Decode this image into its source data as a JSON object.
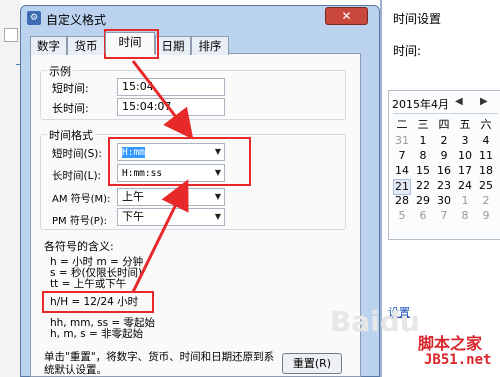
{
  "background_window": {
    "title": "时间设置",
    "label": "时间:",
    "calendar": {
      "month_label": "2015年4月",
      "prev": "◀",
      "next": "▶",
      "weekdays": [
        "二",
        "三",
        "四",
        "五",
        "六"
      ],
      "rows": [
        [
          "31",
          "1",
          "2",
          "3",
          "4"
        ],
        [
          "7",
          "8",
          "9",
          "10",
          "11"
        ],
        [
          "14",
          "15",
          "16",
          "17",
          "18"
        ],
        [
          "21",
          "22",
          "23",
          "24",
          "25"
        ],
        [
          "28",
          "29",
          "30",
          "1",
          "2"
        ],
        [
          "5",
          "6",
          "7",
          "8",
          "9"
        ]
      ],
      "selected": "21"
    },
    "link": "设置"
  },
  "dialog": {
    "icon": "⚙",
    "title": "自定义格式",
    "close": "✕",
    "tabs": [
      "数字",
      "货币",
      "时间",
      "日期",
      "排序"
    ],
    "active_tab": "时间",
    "example_group": {
      "label": "示例",
      "short_time_label": "短时间:",
      "short_time_value": "15:04",
      "long_time_label": "长时间:",
      "long_time_value": "15:04:07"
    },
    "format_group": {
      "label": "时间格式",
      "short_time_label": "短时间(S):",
      "short_time_value": "H:mm",
      "long_time_label": "长时间(L):",
      "long_time_value": "H:mm:ss",
      "am_label": "AM 符号(M):",
      "am_value": "上午",
      "pm_label": "PM 符号(P):",
      "pm_value": "下午"
    },
    "meaning_label": "各符号的含义:",
    "meanings": [
      "h = 小时   m = 分钟",
      "s = 秒(仅限长时间)",
      "tt = 上午或下午"
    ],
    "highlight_meaning": "h/H = 12/24 小时",
    "meanings2": [
      "hh, mm, ss = 零起始",
      "h, m, s = 非零起始"
    ],
    "note_line1": "单击\"重置\"，将数字、货币、时间和日期还原到系",
    "note_line2": "统默认设置。",
    "reset_label": "重置(R)"
  },
  "watermark": {
    "logo": "脚本之家",
    "site": "JB51.net",
    "faint": "Baidu"
  },
  "accent_colors": {
    "highlight_red": "#e8292a",
    "selection_blue": "#3399ff",
    "dialog_frame": "#bcd3ef"
  }
}
